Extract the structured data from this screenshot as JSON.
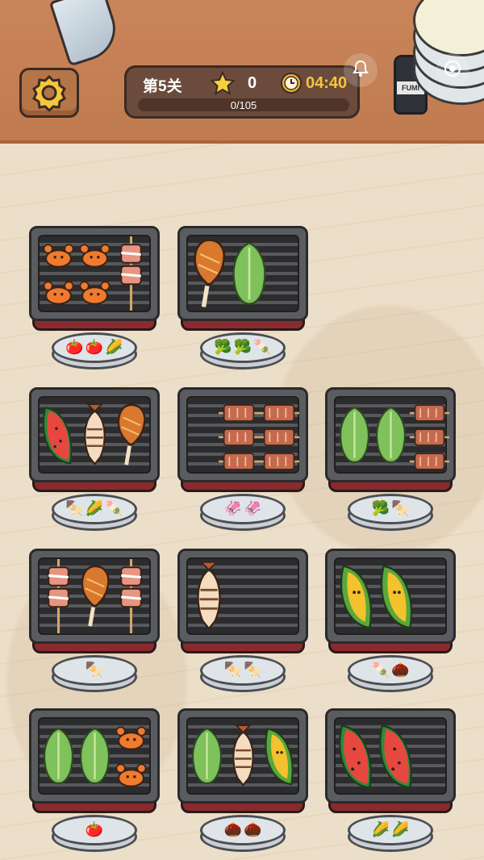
{
  "hud": {
    "level_label": "第5关",
    "stars": "0",
    "timer": "04:40",
    "progress_text": "0/105",
    "progress_fraction": 0
  },
  "jar_label": "FUMI",
  "icons": {
    "settings": "gear-icon",
    "star": "star-icon",
    "clock": "clock-icon",
    "bell": "bell-icon",
    "record": "record-icon"
  },
  "colors": {
    "accent_gold": "#f4b63a",
    "timer_text": "#f6c53c",
    "hud_bg": "#6b4b3c",
    "grill_base": "#8b2a2e"
  },
  "grills": [
    {
      "id": "grill-1",
      "foods": [
        "crab",
        "crab",
        "crab",
        "crab",
        "pork-skewer"
      ],
      "plate": [
        "tomato-skewer",
        "tomato-skewer",
        "corn"
      ]
    },
    {
      "id": "grill-2",
      "foods": [
        "chicken-leg",
        "lettuce"
      ],
      "plate": [
        "broccoli",
        "broccoli",
        "meatball-skewer"
      ]
    },
    {
      "id": "grill-3",
      "foods": [
        "watermelon",
        "fish",
        "chicken-leg"
      ],
      "plate": [
        "fishball-skewer",
        "corn",
        "meatball-skewer"
      ]
    },
    {
      "id": "grill-4",
      "foods": [
        "tofu-skewer",
        "tofu-skewer",
        "tofu-skewer",
        "tofu-skewer",
        "tofu-skewer",
        "tofu-skewer"
      ],
      "plate": [
        "squid",
        "squid"
      ]
    },
    {
      "id": "grill-5",
      "foods": [
        "lettuce",
        "lettuce",
        "tofu-skewer",
        "tofu-skewer",
        "tofu-skewer"
      ],
      "plate": [
        "broccoli",
        "fishball-skewer"
      ]
    },
    {
      "id": "grill-6",
      "foods": [
        "pork-skewer",
        "chicken-leg",
        "pork-skewer"
      ],
      "plate": [
        "veggie-skewer"
      ]
    },
    {
      "id": "grill-7",
      "foods": [
        "fish"
      ],
      "plate": [
        "veggie-skewer",
        "veggie-skewer"
      ]
    },
    {
      "id": "grill-8",
      "foods": [
        "durian",
        "durian"
      ],
      "plate": [
        "meatball-skewer",
        "sea-urchin"
      ]
    },
    {
      "id": "grill-9",
      "foods": [
        "lettuce",
        "lettuce",
        "crab",
        "crab"
      ],
      "plate": [
        "tomato-skewer"
      ]
    },
    {
      "id": "grill-10",
      "foods": [
        "lettuce",
        "fish",
        "durian"
      ],
      "plate": [
        "sea-urchin",
        "sea-urchin"
      ]
    },
    {
      "id": "grill-11",
      "foods": [
        "watermelon",
        "watermelon"
      ],
      "plate": [
        "corn",
        "corn"
      ]
    }
  ]
}
